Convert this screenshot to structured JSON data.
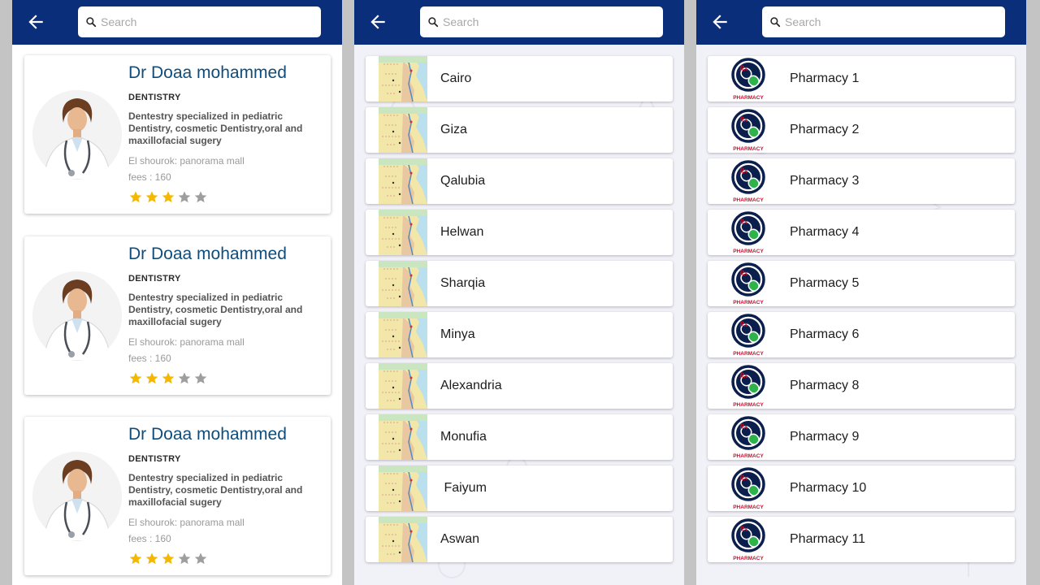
{
  "search": {
    "placeholder": "Search"
  },
  "doctors": [
    {
      "name": "Dr Doaa mohammed",
      "specialty": "DENTISTRY",
      "description": "Dentestry specialized in pediatric Dentistry, cosmetic Dentistry,oral and maxillofacial sugery",
      "address": "El shourok: panorama mall",
      "fees": "fees : 160",
      "rating": 3,
      "rating_max": 5
    },
    {
      "name": "Dr Doaa mohammed",
      "specialty": "DENTISTRY",
      "description": "Dentestry specialized in pediatric Dentistry, cosmetic Dentistry,oral and maxillofacial sugery",
      "address": "El shourok: panorama mall",
      "fees": "fees : 160",
      "rating": 3,
      "rating_max": 5
    },
    {
      "name": "Dr Doaa mohammed",
      "specialty": "DENTISTRY",
      "description": "Dentestry specialized in pediatric Dentistry, cosmetic Dentistry,oral and maxillofacial sugery",
      "address": "El shourok: panorama mall",
      "fees": "fees : 160",
      "rating": 3,
      "rating_max": 5
    }
  ],
  "cities": [
    "Cairo",
    "Giza",
    "Qalubia",
    "Helwan",
    "Sharqia",
    "Minya",
    "Alexandria",
    "Monufia",
    " Faiyum",
    "Aswan"
  ],
  "pharmacies": [
    "Pharmacy 1",
    "Pharmacy 2",
    "Pharmacy 3",
    "Pharmacy 4",
    "Pharmacy 5",
    "Pharmacy 6",
    "Pharmacy 8",
    "Pharmacy 9",
    "Pharmacy 10",
    "Pharmacy 11"
  ],
  "pharmacy_logo_text": "PHARMACY",
  "pharmacy_logo_rx": "Rx",
  "colors": {
    "appbar": "#0b2e7a",
    "doctor_name": "#0f4c7a",
    "star_filled": "#f5b800",
    "star_empty": "#9e9e9e",
    "logo_red": "#c8102e",
    "logo_navy": "#0b1f4d",
    "logo_green": "#2db34a"
  },
  "icons": {
    "back": "arrow-left-icon",
    "search": "search-icon",
    "star": "star-icon",
    "city_thumb": "egypt-map-icon",
    "pharmacy_thumb": "pharmacy-logo-icon"
  }
}
